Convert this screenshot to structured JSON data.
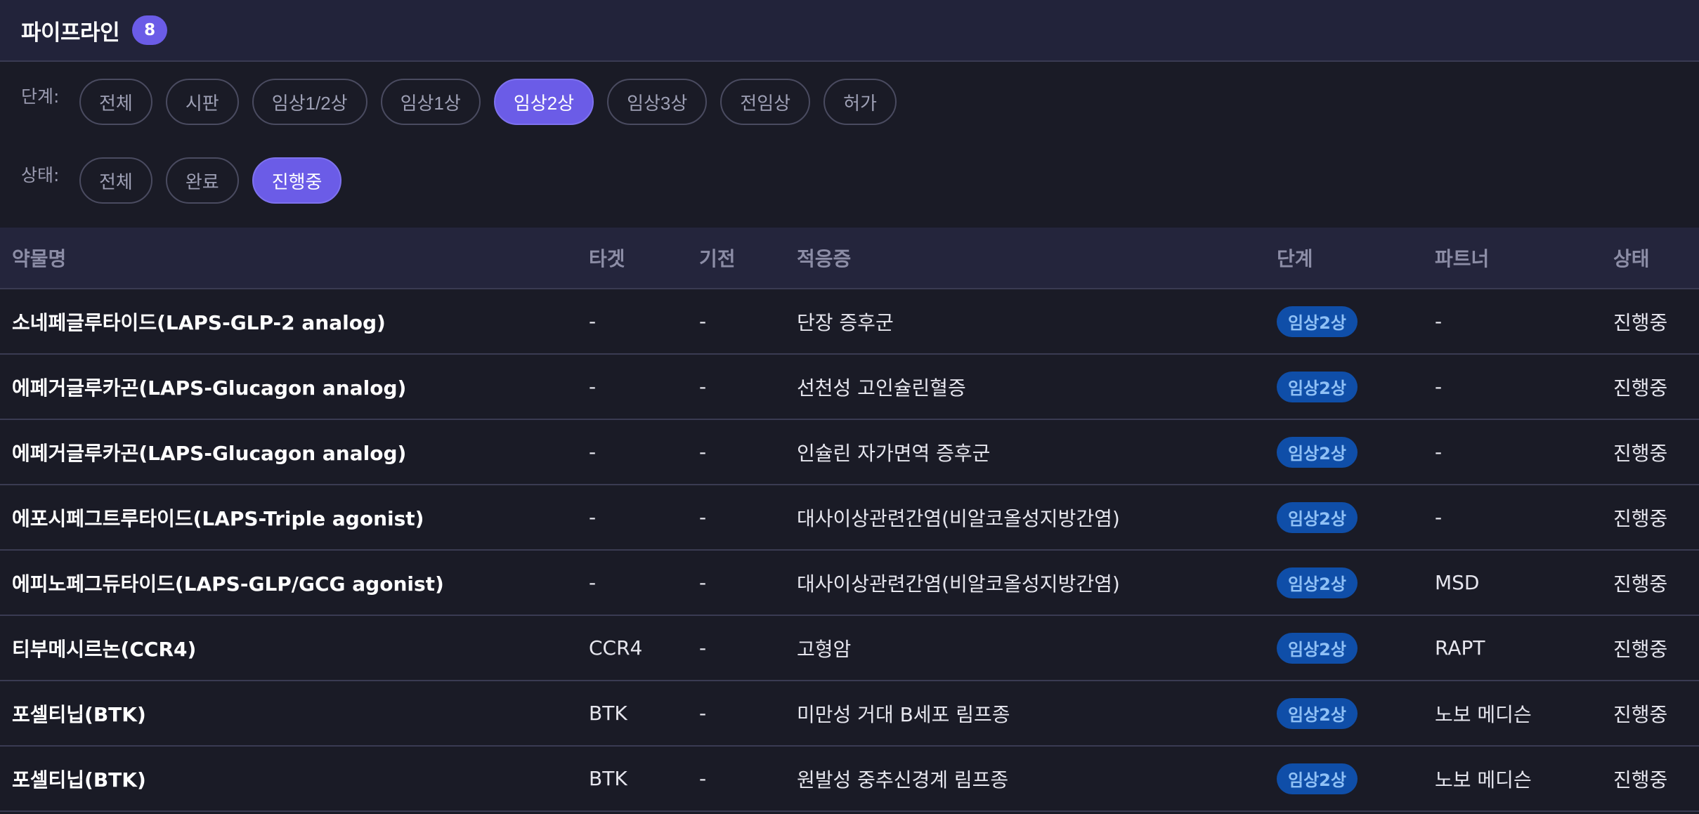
{
  "header": {
    "title": "파이프라인",
    "count": "8"
  },
  "filters": {
    "phase_label": "단계:",
    "phase_options": [
      "전체",
      "시판",
      "임상1/2상",
      "임상1상",
      "임상2상",
      "임상3상",
      "전임상",
      "허가"
    ],
    "phase_selected": "임상2상",
    "status_label": "상태:",
    "status_options": [
      "전체",
      "완료",
      "진행중"
    ],
    "status_selected": "진행중"
  },
  "table": {
    "columns": [
      "약물명",
      "타겟",
      "기전",
      "적응증",
      "단계",
      "파트너",
      "상태"
    ],
    "rows": [
      {
        "drug": "소네페글루타이드(LAPS-GLP-2 analog)",
        "target": "-",
        "mechanism": "-",
        "indication": "단장 증후군",
        "phase": "임상2상",
        "partner": "-",
        "status": "진행중"
      },
      {
        "drug": "에페거글루카곤(LAPS-Glucagon analog)",
        "target": "-",
        "mechanism": "-",
        "indication": "선천성 고인슐린혈증",
        "phase": "임상2상",
        "partner": "-",
        "status": "진행중"
      },
      {
        "drug": "에페거글루카곤(LAPS-Glucagon analog)",
        "target": "-",
        "mechanism": "-",
        "indication": "인슐린 자가면역 증후군",
        "phase": "임상2상",
        "partner": "-",
        "status": "진행중"
      },
      {
        "drug": "에포시페그트루타이드(LAPS-Triple agonist)",
        "target": "-",
        "mechanism": "-",
        "indication": "대사이상관련간염(비알코올성지방간염)",
        "phase": "임상2상",
        "partner": "-",
        "status": "진행중"
      },
      {
        "drug": "에피노페그듀타이드(LAPS-GLP/GCG agonist)",
        "target": "-",
        "mechanism": "-",
        "indication": "대사이상관련간염(비알코올성지방간염)",
        "phase": "임상2상",
        "partner": "MSD",
        "status": "진행중"
      },
      {
        "drug": "티부메시르논(CCR4)",
        "target": "CCR4",
        "mechanism": "-",
        "indication": "고형암",
        "phase": "임상2상",
        "partner": "RAPT",
        "status": "진행중"
      },
      {
        "drug": "포셀티닙(BTK)",
        "target": "BTK",
        "mechanism": "-",
        "indication": "미만성 거대 B세포 림프종",
        "phase": "임상2상",
        "partner": "노보 메디슨",
        "status": "진행중"
      },
      {
        "drug": "포셀티닙(BTK)",
        "target": "BTK",
        "mechanism": "-",
        "indication": "원발성 중추신경계 림프종",
        "phase": "임상2상",
        "partner": "노보 메디슨",
        "status": "진행중"
      }
    ]
  },
  "colors": {
    "background": "#1a1b26",
    "header_bg": "#22233a",
    "accent": "#6b5ce7",
    "phase_badge_bg": "#0f4ea8",
    "phase_badge_text": "#8fc0f5"
  }
}
